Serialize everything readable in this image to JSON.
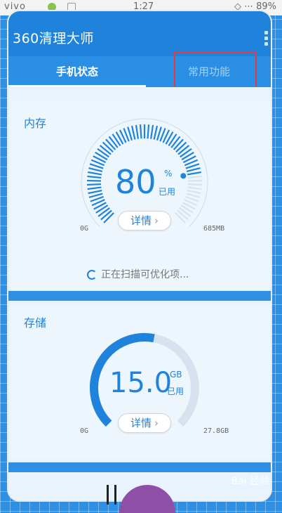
{
  "status_bar": {
    "carrier": "vivo",
    "time": "1:27",
    "right": "◇ ⋯ 89%"
  },
  "app": {
    "logo": "360清理大师"
  },
  "tabs": [
    {
      "label": "手机状态",
      "active": true
    },
    {
      "label": "常用功能",
      "active": false
    }
  ],
  "memory": {
    "title": "内存",
    "percent": "80",
    "percent_sign": "%",
    "used_label": "已用",
    "min_label": "0G",
    "max_label": "685MB",
    "detail_button": "详情",
    "scan_text": "正在扫描可优化项...",
    "level": 0.8
  },
  "storage": {
    "title": "存储",
    "value": "15.0",
    "unit": "GB",
    "used_label": "已用",
    "min_label": "0G",
    "max_label": "27.8GB",
    "detail_button": "详情",
    "level": 0.54
  },
  "colors": {
    "primary": "#1f83dc",
    "tab_bg": "#2a8ee5",
    "highlight": "#e23b3b",
    "gauge_track": "#d6e3ee"
  },
  "watermark": "Bai 经验"
}
